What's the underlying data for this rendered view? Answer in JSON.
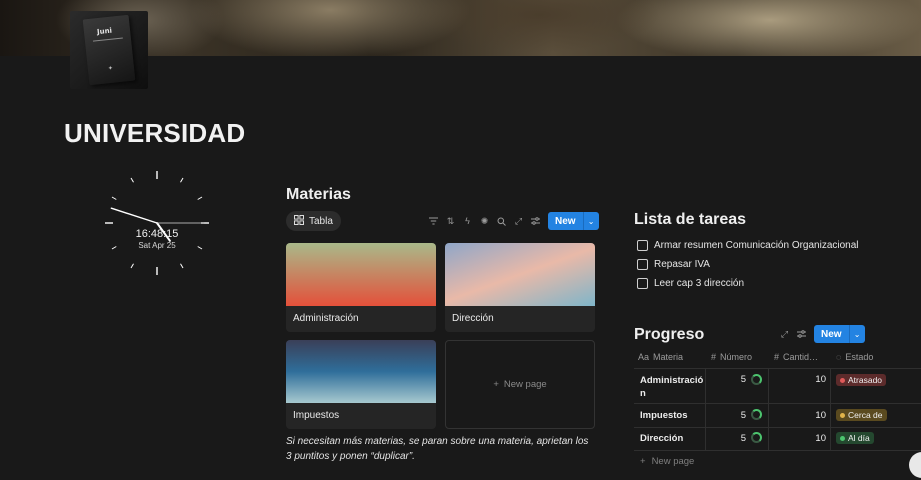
{
  "page": {
    "title": "UNIVERSIDAD",
    "icon_text": "Juni"
  },
  "clock": {
    "time": "16:48:15",
    "date": "Sat Apr 25",
    "hour_hand_deg": 144,
    "minute_hand_deg": 288,
    "second_hand_deg": 90
  },
  "materias": {
    "title": "Materias",
    "view_tab": "Tabla",
    "new_label": "New",
    "toolbar_icons": [
      "filter-icon",
      "sort-icon",
      "lightning-icon",
      "sparkle-icon",
      "search-icon",
      "expand-icon",
      "settings-icon"
    ],
    "cards": [
      {
        "label": "Administración",
        "gradient": [
          "#a9b98a",
          "#e4503a"
        ]
      },
      {
        "label": "Dirección",
        "gradient": [
          "#8fa6c8",
          "#e9b9a8",
          "#7fb5c9"
        ]
      },
      {
        "label": "Impuestos",
        "gradient": [
          "#3a3f58",
          "#2f6e9a",
          "#a7c9cf"
        ]
      }
    ],
    "new_page_label": "New page",
    "note": "Si necesitan más materias, se paran sobre una materia, aprietan los 3 puntitos y ponen “duplicar”."
  },
  "tareas": {
    "title": "Lista de tareas",
    "items": [
      "Armar resumen Comunicación Organizacional",
      "Repasar IVA",
      "Leer cap 3 dirección"
    ]
  },
  "progreso": {
    "title": "Progreso",
    "new_label": "New",
    "columns": [
      {
        "label": "Materia",
        "icon": "Aa"
      },
      {
        "label": "Número",
        "icon": "#"
      },
      {
        "label": "Cantid…",
        "icon": "#"
      },
      {
        "label": "Estado",
        "icon": "◌"
      }
    ],
    "rows": [
      {
        "materia": "Administració\nn",
        "numero": "5",
        "cantidad": "10",
        "estado": "Atrasado",
        "estado_bg": "#5c2b2b",
        "estado_dot": "#e05a5a"
      },
      {
        "materia": "Impuestos",
        "numero": "5",
        "cantidad": "10",
        "estado": "Cerca de",
        "estado_bg": "#5a4a1f",
        "estado_dot": "#e0b34a"
      },
      {
        "materia": "Dirección",
        "numero": "5",
        "cantidad": "10",
        "estado": "Al día",
        "estado_bg": "#24482f",
        "estado_dot": "#4cc46e"
      }
    ],
    "new_page_label": "New page"
  },
  "colors": {
    "background": "#191919",
    "accent": "#2383e2"
  }
}
